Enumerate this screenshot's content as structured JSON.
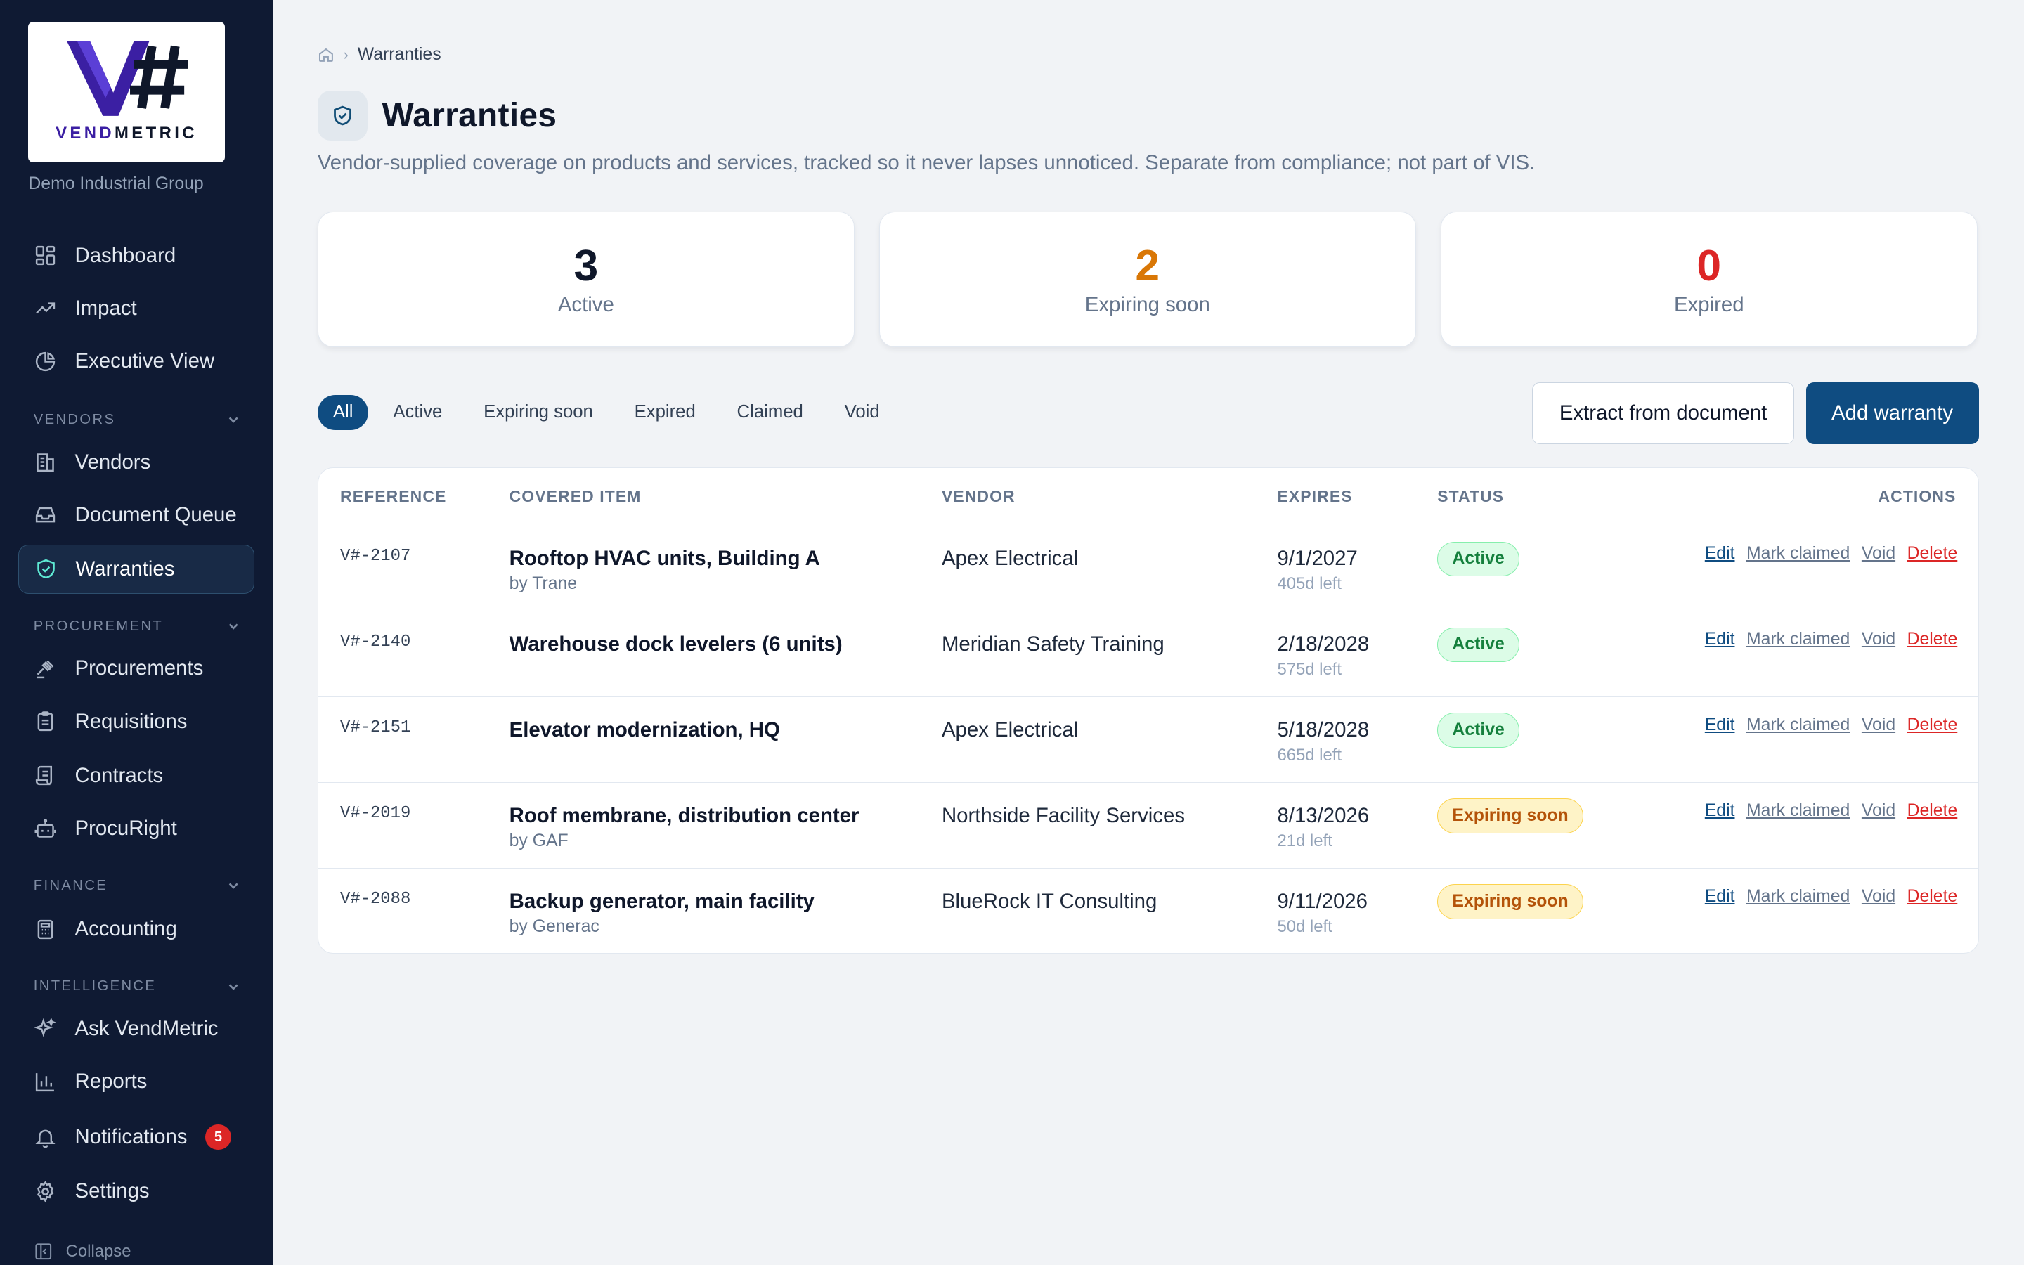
{
  "brand": {
    "logo_text_a": "VEND",
    "logo_text_b": "METRIC",
    "org": "Demo Industrial Group",
    "colors": {
      "sidebar_bg": "#0f1a33",
      "accent": "#0f4c81",
      "active_icon": "#5eead4"
    }
  },
  "sidebar": {
    "top_items": [
      {
        "label": "Dashboard",
        "icon": "grid-icon"
      },
      {
        "label": "Impact",
        "icon": "trending-up-icon"
      },
      {
        "label": "Executive View",
        "icon": "pie-chart-icon"
      }
    ],
    "sections": {
      "vendors": "VENDORS",
      "procurement": "PROCUREMENT",
      "finance": "FINANCE",
      "intelligence": "INTELLIGENCE"
    },
    "vendors_items": [
      {
        "label": "Vendors",
        "icon": "building-icon"
      },
      {
        "label": "Document Queue",
        "icon": "inbox-icon"
      },
      {
        "label": "Warranties",
        "icon": "shield-check-icon",
        "active": true
      }
    ],
    "procurement_items": [
      {
        "label": "Procurements",
        "icon": "gavel-icon"
      },
      {
        "label": "Requisitions",
        "icon": "clipboard-icon"
      },
      {
        "label": "Contracts",
        "icon": "scroll-icon"
      },
      {
        "label": "ProcuRight",
        "icon": "robot-icon"
      }
    ],
    "finance_items": [
      {
        "label": "Accounting",
        "icon": "calculator-icon"
      }
    ],
    "intelligence_items": [
      {
        "label": "Ask VendMetric",
        "icon": "sparkles-icon"
      },
      {
        "label": "Reports",
        "icon": "bar-chart-icon"
      },
      {
        "label": "Notifications",
        "icon": "bell-icon",
        "badge": "5"
      },
      {
        "label": "Settings",
        "icon": "gear-icon"
      }
    ],
    "collapse_label": "Collapse"
  },
  "header": {
    "breadcrumb_current": "Warranties",
    "title": "Warranties",
    "subtitle": "Vendor-supplied coverage on products and services, tracked so it never lapses unnoticed. Separate from compliance; not part of VIS."
  },
  "stats": [
    {
      "value": "3",
      "label": "Active",
      "color": "#0f172a"
    },
    {
      "value": "2",
      "label": "Expiring soon",
      "color": "#d97706"
    },
    {
      "value": "0",
      "label": "Expired",
      "color": "#dc2626"
    }
  ],
  "filters": [
    "All",
    "Active",
    "Expiring soon",
    "Expired",
    "Claimed",
    "Void"
  ],
  "buttons": {
    "extract": "Extract from document",
    "add": "Add warranty"
  },
  "table": {
    "headers": {
      "reference": "REFERENCE",
      "item": "COVERED ITEM",
      "vendor": "VENDOR",
      "expires": "EXPIRES",
      "status": "STATUS",
      "actions": "ACTIONS"
    },
    "action_labels": {
      "edit": "Edit",
      "claim": "Mark claimed",
      "void": "Void",
      "delete": "Delete"
    },
    "rows": [
      {
        "ref": "V#-2107",
        "item": "Rooftop HVAC units, Building A",
        "by": "by Trane",
        "vendor": "Apex Electrical",
        "expires": "9/1/2027",
        "left": "405d left",
        "status": "Active",
        "kind": "active"
      },
      {
        "ref": "V#-2140",
        "item": "Warehouse dock levelers (6 units)",
        "by": "",
        "vendor": "Meridian Safety Training",
        "expires": "2/18/2028",
        "left": "575d left",
        "status": "Active",
        "kind": "active"
      },
      {
        "ref": "V#-2151",
        "item": "Elevator modernization, HQ",
        "by": "",
        "vendor": "Apex Electrical",
        "expires": "5/18/2028",
        "left": "665d left",
        "status": "Active",
        "kind": "active"
      },
      {
        "ref": "V#-2019",
        "item": "Roof membrane, distribution center",
        "by": "by GAF",
        "vendor": "Northside Facility Services",
        "expires": "8/13/2026",
        "left": "21d left",
        "status": "Expiring soon",
        "kind": "soon"
      },
      {
        "ref": "V#-2088",
        "item": "Backup generator, main facility",
        "by": "by Generac",
        "vendor": "BlueRock IT Consulting",
        "expires": "9/11/2026",
        "left": "50d left",
        "status": "Expiring soon",
        "kind": "soon"
      }
    ]
  }
}
